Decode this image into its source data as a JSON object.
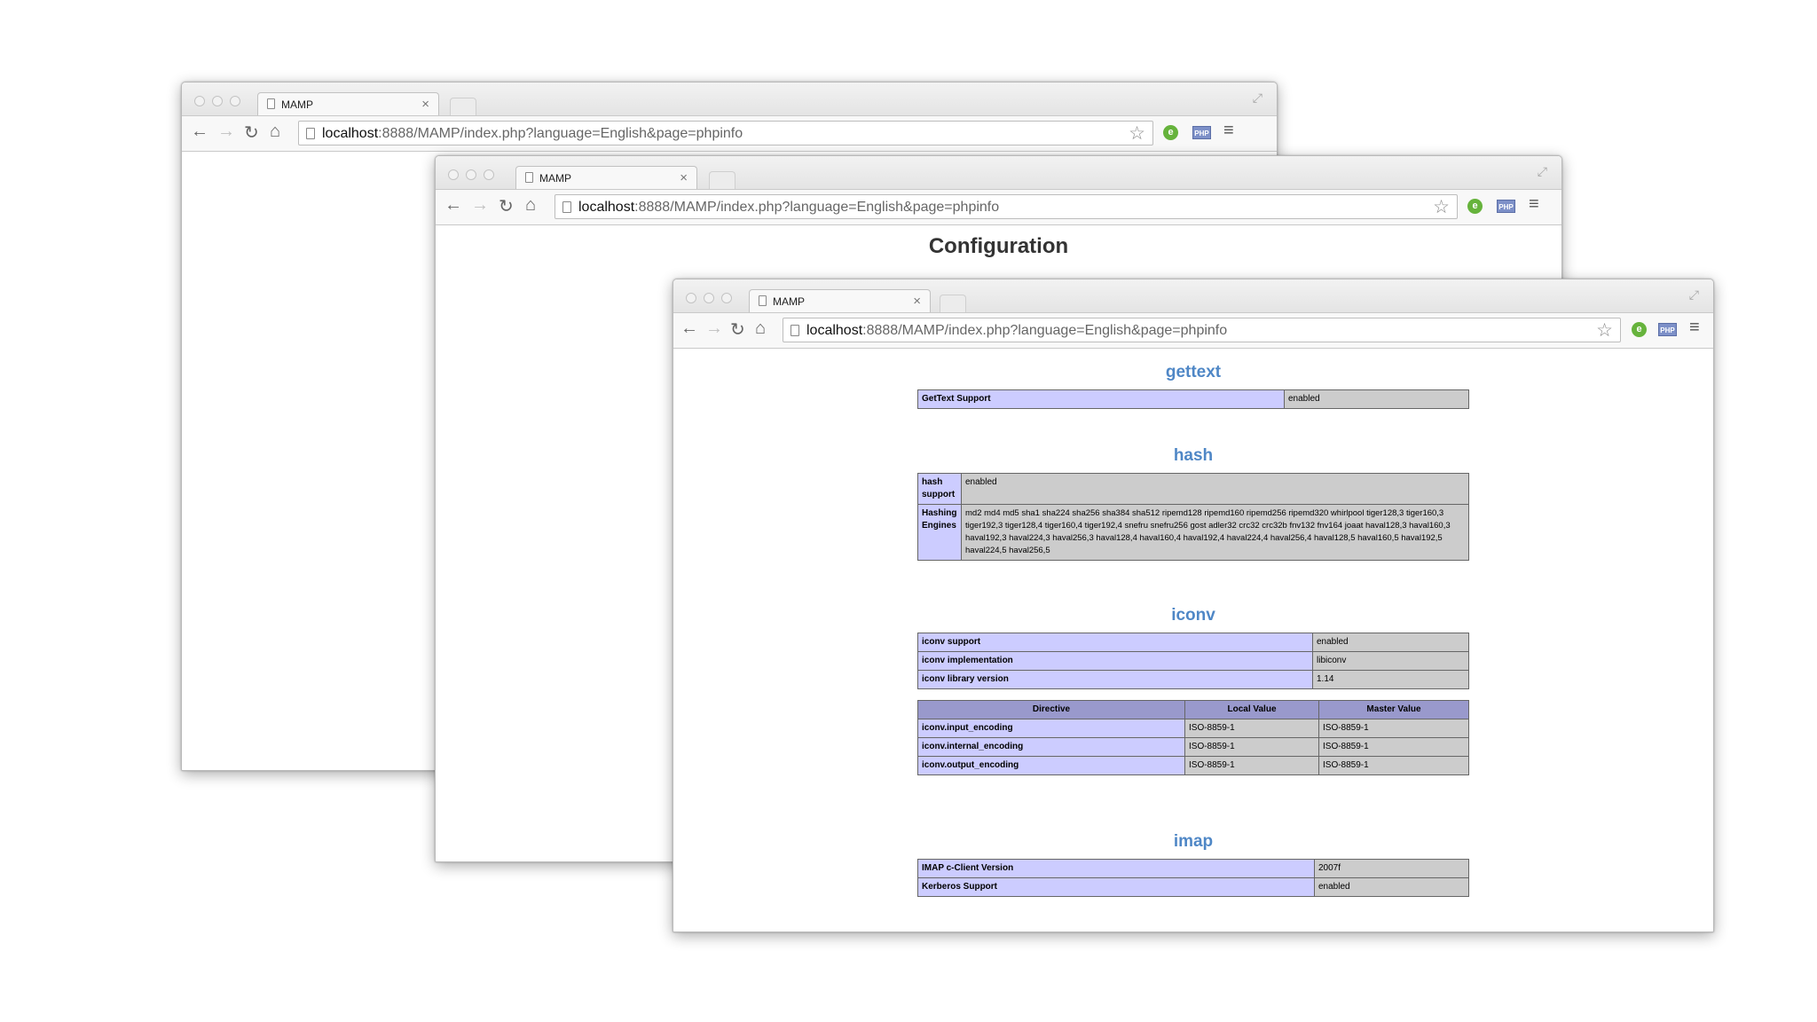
{
  "browser": {
    "tab_title": "MAMP",
    "tab_close": "×",
    "url_host": "localhost",
    "url_path": ":8888/MAMP/index.php?language=English&page=phpinfo",
    "icons": [
      "back-arrow-icon",
      "forward-arrow-icon",
      "reload-icon",
      "home-icon",
      "star-icon",
      "evernote-icon",
      "php-icon",
      "menu-icon"
    ]
  },
  "middle_window": {
    "heading": "Configuration"
  },
  "phpinfo": {
    "gettext": {
      "title": "gettext",
      "rows": [
        {
          "name": "GetText Support",
          "value": "enabled"
        }
      ]
    },
    "hash": {
      "title": "hash",
      "rows": [
        {
          "name": "hash support",
          "value": "enabled"
        },
        {
          "name": "Hashing Engines",
          "value": "md2 md4 md5 sha1 sha224 sha256 sha384 sha512 ripemd128 ripemd160 ripemd256 ripemd320 whirlpool tiger128,3 tiger160,3 tiger192,3 tiger128,4 tiger160,4 tiger192,4 snefru snefru256 gost adler32 crc32 crc32b fnv132 fnv164 joaat haval128,3 haval160,3 haval192,3 haval224,3 haval256,3 haval128,4 haval160,4 haval192,4 haval224,4 haval256,4 haval128,5 haval160,5 haval192,5 haval224,5 haval256,5"
        }
      ]
    },
    "iconv": {
      "title": "iconv",
      "rows": [
        {
          "name": "iconv support",
          "value": "enabled"
        },
        {
          "name": "iconv implementation",
          "value": "libiconv"
        },
        {
          "name": "iconv library version",
          "value": "1.14"
        }
      ],
      "directive_headers": [
        "Directive",
        "Local Value",
        "Master Value"
      ],
      "directives": [
        {
          "name": "iconv.input_encoding",
          "local": "ISO-8859-1",
          "master": "ISO-8859-1"
        },
        {
          "name": "iconv.internal_encoding",
          "local": "ISO-8859-1",
          "master": "ISO-8859-1"
        },
        {
          "name": "iconv.output_encoding",
          "local": "ISO-8859-1",
          "master": "ISO-8859-1"
        }
      ]
    },
    "imap": {
      "title": "imap",
      "rows": [
        {
          "name": "IMAP c-Client Version",
          "value": "2007f"
        },
        {
          "name": "Kerberos Support",
          "value": "enabled"
        }
      ]
    }
  }
}
